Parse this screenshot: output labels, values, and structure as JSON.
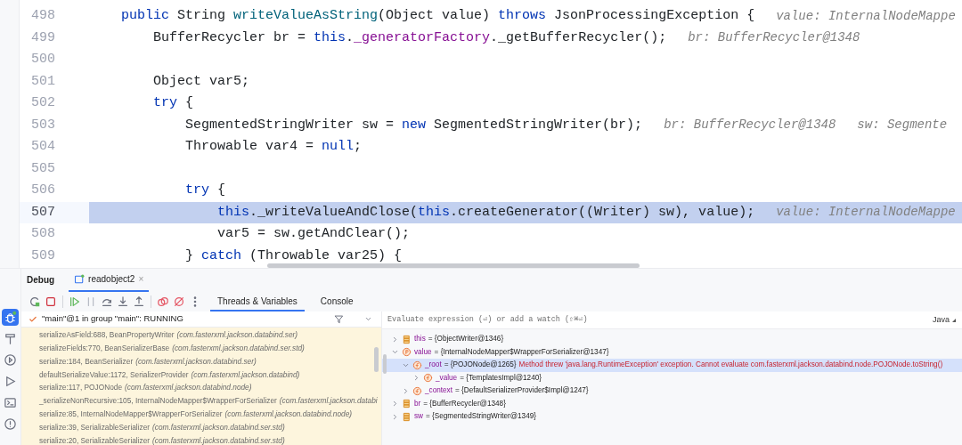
{
  "editor": {
    "lines": [
      {
        "number": "498",
        "current": false,
        "tokens": [
          {
            "kind": "keyword",
            "text": "    public"
          },
          {
            "kind": "plain",
            "text": " String "
          },
          {
            "kind": "method",
            "text": "writeValueAsString"
          },
          {
            "kind": "plain",
            "text": "(Object value) "
          },
          {
            "kind": "keyword",
            "text": "throws"
          },
          {
            "kind": "plain",
            "text": " JsonProcessingException {"
          }
        ],
        "hints": [
          "value: InternalNodeMappe"
        ]
      },
      {
        "number": "499",
        "current": false,
        "tokens": [
          {
            "kind": "plain",
            "text": "        BufferRecycler br = "
          },
          {
            "kind": "keyword",
            "text": "this"
          },
          {
            "kind": "plain",
            "text": "."
          },
          {
            "kind": "field",
            "text": "_generatorFactory"
          },
          {
            "kind": "plain",
            "text": "._getBufferRecycler();"
          }
        ],
        "hints": [
          "br: BufferRecycler@1348"
        ]
      },
      {
        "number": "500",
        "current": false
      },
      {
        "number": "501",
        "current": false,
        "tokens": [
          {
            "kind": "plain",
            "text": "        Object var5;"
          }
        ]
      },
      {
        "number": "502",
        "current": false,
        "tokens": [
          {
            "kind": "keyword",
            "text": "        try"
          },
          {
            "kind": "plain",
            "text": " {"
          }
        ]
      },
      {
        "number": "503",
        "current": false,
        "tokens": [
          {
            "kind": "plain",
            "text": "            SegmentedStringWriter sw = "
          },
          {
            "kind": "keyword",
            "text": "new"
          },
          {
            "kind": "plain",
            "text": " SegmentedStringWriter(br);"
          }
        ],
        "hints": [
          "br: BufferRecycler@1348",
          "sw: Segmente"
        ]
      },
      {
        "number": "504",
        "current": false,
        "tokens": [
          {
            "kind": "plain",
            "text": "            Throwable var4 = "
          },
          {
            "kind": "keyword",
            "text": "null"
          },
          {
            "kind": "plain",
            "text": ";"
          }
        ]
      },
      {
        "number": "505",
        "current": false
      },
      {
        "number": "506",
        "current": false,
        "tokens": [
          {
            "kind": "keyword",
            "text": "            try"
          },
          {
            "kind": "plain",
            "text": " {"
          }
        ]
      },
      {
        "number": "507",
        "current": true,
        "tokens": [
          {
            "kind": "keyword",
            "text": "                this"
          },
          {
            "kind": "plain",
            "text": "._writeValueAndClose("
          },
          {
            "kind": "keyword",
            "text": "this"
          },
          {
            "kind": "plain",
            "text": ".createGenerator((Writer) sw), value);"
          }
        ],
        "hints": [
          "value: InternalNodeMappe"
        ]
      },
      {
        "number": "508",
        "current": false,
        "tokens": [
          {
            "kind": "plain",
            "text": "                var5 = sw.getAndClear();"
          }
        ]
      },
      {
        "number": "509",
        "current": false,
        "tokens": [
          {
            "kind": "plain",
            "text": "            } "
          },
          {
            "kind": "keyword",
            "text": "catch"
          },
          {
            "kind": "plain",
            "text": " (Throwable var25) {"
          }
        ]
      }
    ]
  },
  "tool_window": {
    "title": "Debug",
    "session_tabs": [
      {
        "label": "readobject2",
        "close": "×",
        "selected": true
      }
    ],
    "view_tabs": [
      {
        "label": "Threads & Variables",
        "selected": true
      },
      {
        "label": "Console",
        "selected": false
      }
    ]
  },
  "sidebar": {
    "items": [
      {
        "kind": "debug",
        "selected": true
      },
      {
        "kind": "build",
        "selected": false
      },
      {
        "kind": "services",
        "selected": false
      },
      {
        "kind": "run",
        "selected": false
      },
      {
        "kind": "terminal",
        "selected": false
      },
      {
        "kind": "problems",
        "selected": false
      }
    ]
  },
  "thread": {
    "label": "\"main\"@1 in group \"main\": RUNNING"
  },
  "frames": [
    {
      "method": "serializeAsField:688, BeanPropertyWriter",
      "package": "(com.fasterxml.jackson.databind.ser)"
    },
    {
      "method": "serializeFields:770, BeanSerializerBase",
      "package": "(com.fasterxml.jackson.databind.ser.std)"
    },
    {
      "method": "serialize:184, BeanSerializer",
      "package": "(com.fasterxml.jackson.databind.ser)"
    },
    {
      "method": "defaultSerializeValue:1172, SerializerProvider",
      "package": "(com.fasterxml.jackson.databind)"
    },
    {
      "method": "serialize:117, POJONode",
      "package": "(com.fasterxml.jackson.databind.node)"
    },
    {
      "method": "_serializeNonRecursive:105, InternalNodeMapper$WrapperForSerializer",
      "package": "(com.fasterxml.jackson.databi"
    },
    {
      "method": "serialize:85, InternalNodeMapper$WrapperForSerializer",
      "package": "(com.fasterxml.jackson.databind.node)"
    },
    {
      "method": "serialize:39, SerializableSerializer",
      "package": "(com.fasterxml.jackson.databind.ser.std)"
    },
    {
      "method": "serialize:20, SerializableSerializer",
      "package": "(com.fasterxml.jackson.databind.ser.std)"
    }
  ],
  "evaluate": {
    "placeholder": "Evaluate expression (⏎) or add a watch (⇧⌘⏎)",
    "language": "Java"
  },
  "variables": [
    {
      "kind": "local",
      "name": "this",
      "value": "= {ObjectWriter@1346}",
      "expanded": false,
      "selected": false
    },
    {
      "kind": "param",
      "name": "value",
      "value": "= {InternalNodeMapper$WrapperForSerializer@1347}",
      "expanded": true,
      "selected": false,
      "children": [
        {
          "kind": "field",
          "name": "_root",
          "value": "= {POJONode@1265}",
          "error": "Method threw 'java.lang.RuntimeException' exception. Cannot evaluate com.fasterxml.jackson.databind.node.POJONode.toString()",
          "expanded": true,
          "selected": true,
          "children": [
            {
              "kind": "field",
              "name": "_value",
              "value": "= {TemplatesImpl@1240}",
              "expanded": false,
              "selected": false
            }
          ]
        },
        {
          "kind": "field",
          "name": "_context",
          "value": "= {DefaultSerializerProvider$Impl@1247}",
          "expanded": false,
          "selected": false
        }
      ]
    },
    {
      "kind": "local",
      "name": "br",
      "value": "= {BufferRecycler@1348}",
      "expanded": false,
      "selected": false
    },
    {
      "kind": "local",
      "name": "sw",
      "value": "= {SegmentedStringWriter@1349}",
      "expanded": false,
      "selected": false
    }
  ]
}
